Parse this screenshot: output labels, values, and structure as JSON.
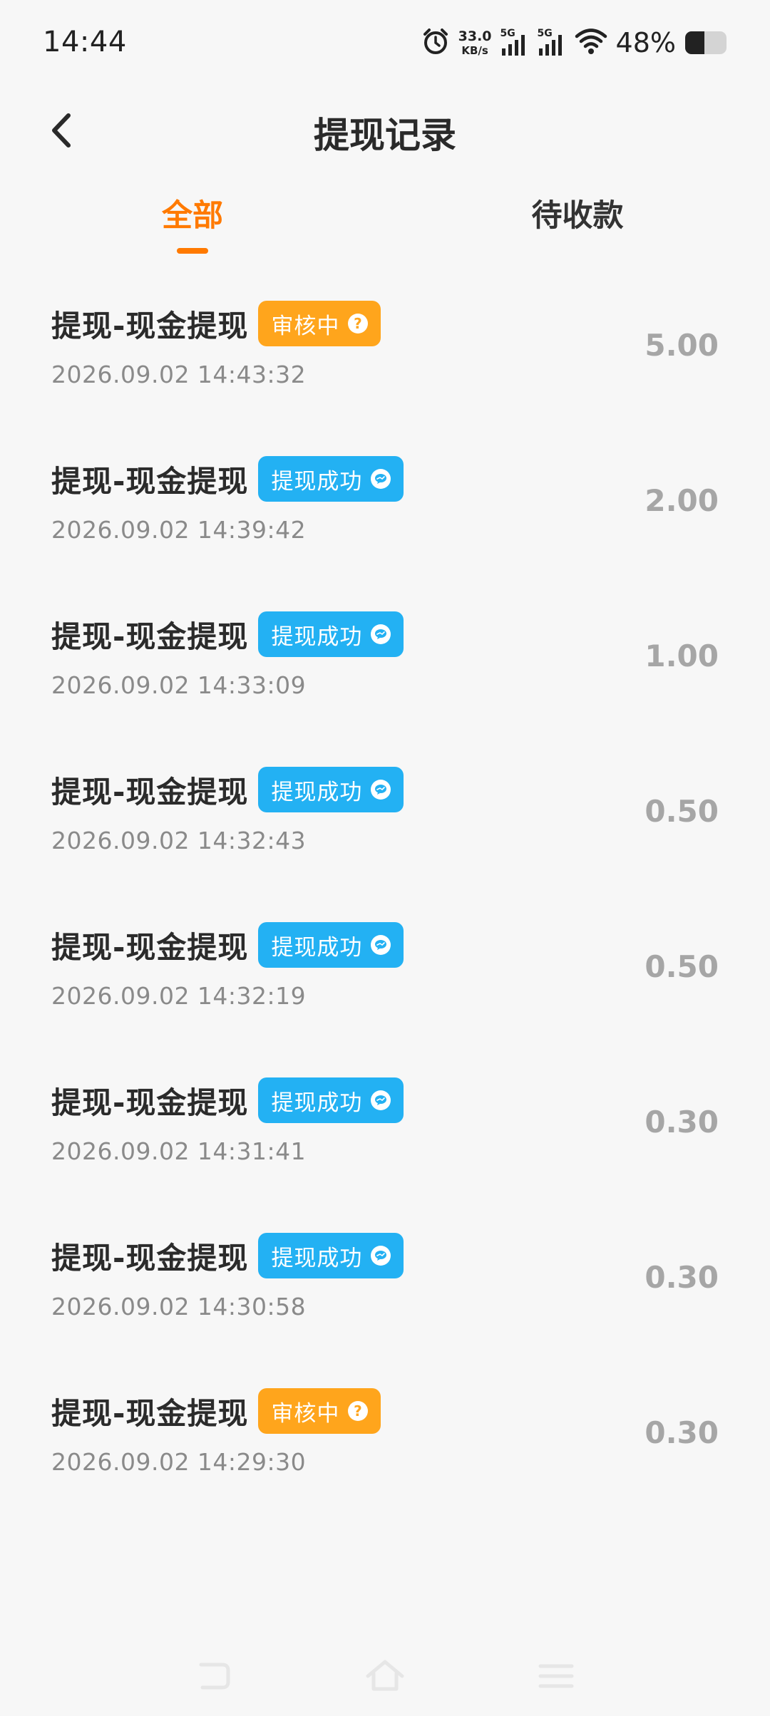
{
  "status_bar": {
    "time": "14:44",
    "net_speed_value": "33.0",
    "net_speed_unit": "KB/s",
    "sim1": "5G",
    "sim2": "5G",
    "battery": "48%"
  },
  "header": {
    "title": "提现记录"
  },
  "tabs": {
    "all": "全部",
    "pending": "待收款",
    "active": "all",
    "active_color": "#ff7a00"
  },
  "records": [
    {
      "title": "提现-现金提现",
      "status": "审核中",
      "status_type": "review",
      "status_icon": "question-icon",
      "time": "2026.09.02 14:43:32",
      "amount": "5.00"
    },
    {
      "title": "提现-现金提现",
      "status": "提现成功",
      "status_type": "success",
      "status_icon": "wechat-icon",
      "time": "2026.09.02 14:39:42",
      "amount": "2.00"
    },
    {
      "title": "提现-现金提现",
      "status": "提现成功",
      "status_type": "success",
      "status_icon": "wechat-icon",
      "time": "2026.09.02 14:33:09",
      "amount": "1.00"
    },
    {
      "title": "提现-现金提现",
      "status": "提现成功",
      "status_type": "success",
      "status_icon": "wechat-icon",
      "time": "2026.09.02 14:32:43",
      "amount": "0.50"
    },
    {
      "title": "提现-现金提现",
      "status": "提现成功",
      "status_type": "success",
      "status_icon": "wechat-icon",
      "time": "2026.09.02 14:32:19",
      "amount": "0.50"
    },
    {
      "title": "提现-现金提现",
      "status": "提现成功",
      "status_type": "success",
      "status_icon": "wechat-icon",
      "time": "2026.09.02 14:31:41",
      "amount": "0.30"
    },
    {
      "title": "提现-现金提现",
      "status": "提现成功",
      "status_type": "success",
      "status_icon": "wechat-icon",
      "time": "2026.09.02 14:30:58",
      "amount": "0.30"
    },
    {
      "title": "提现-现金提现",
      "status": "审核中",
      "status_type": "review",
      "status_icon": "question-icon",
      "time": "2026.09.02 14:29:30",
      "amount": "0.30"
    }
  ],
  "colors": {
    "review_badge": "#ffa51c",
    "success_badge": "#23b1f3",
    "amount_text": "#a6a6a6"
  }
}
